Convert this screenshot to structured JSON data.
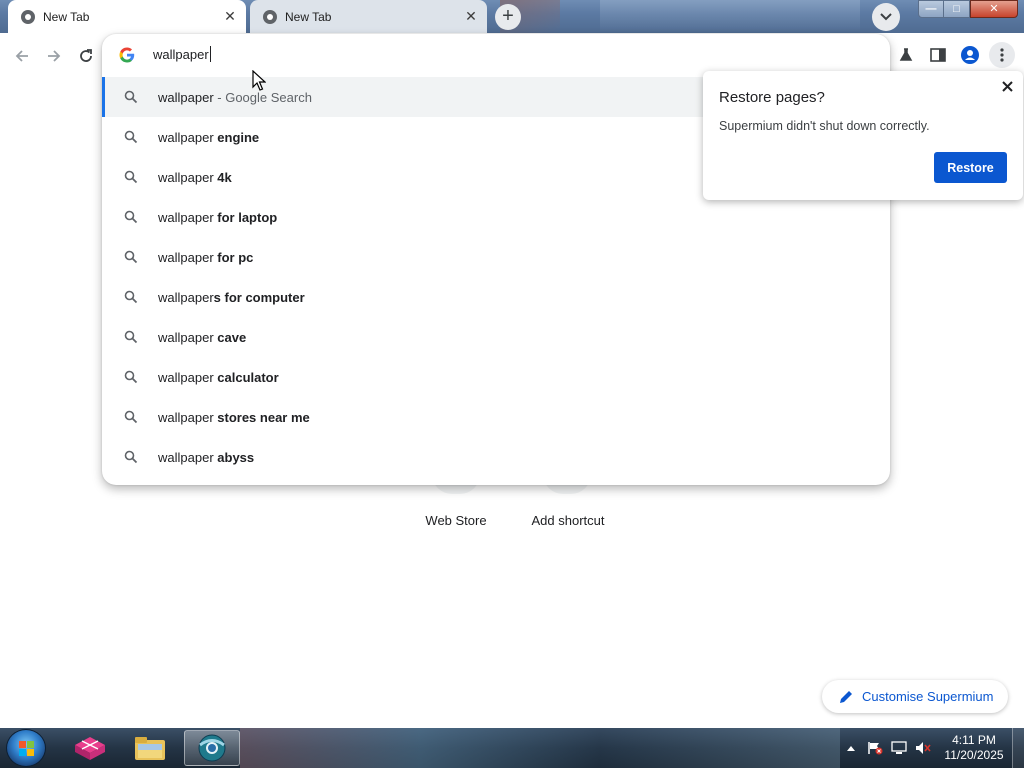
{
  "tabs": [
    {
      "title": "New Tab",
      "active": true
    },
    {
      "title": "New Tab",
      "active": false
    }
  ],
  "omnibox": {
    "value": "wallpaper"
  },
  "suggestions": [
    {
      "prefix": "wallpaper",
      "bold": "",
      "suffix": " - Google Search",
      "selected": true
    },
    {
      "prefix": "wallpaper",
      "bold": " engine",
      "suffix": "",
      "selected": false
    },
    {
      "prefix": "wallpaper",
      "bold": " 4k",
      "suffix": "",
      "selected": false
    },
    {
      "prefix": "wallpaper",
      "bold": " for laptop",
      "suffix": "",
      "selected": false
    },
    {
      "prefix": "wallpaper",
      "bold": " for pc",
      "suffix": "",
      "selected": false
    },
    {
      "prefix": "wallpaper",
      "bold": "s for computer",
      "suffix": "",
      "selected": false
    },
    {
      "prefix": "wallpaper",
      "bold": " cave",
      "suffix": "",
      "selected": false
    },
    {
      "prefix": "wallpaper",
      "bold": " calculator",
      "suffix": "",
      "selected": false
    },
    {
      "prefix": "wallpaper",
      "bold": " stores near me",
      "suffix": "",
      "selected": false
    },
    {
      "prefix": "wallpaper",
      "bold": " abyss",
      "suffix": "",
      "selected": false
    }
  ],
  "restore_dialog": {
    "title": "Restore pages?",
    "message": "Supermium didn't shut down correctly.",
    "button": "Restore"
  },
  "shortcuts": [
    {
      "label": "Web Store"
    },
    {
      "label": "Add shortcut"
    }
  ],
  "customise_button": "Customise Supermium",
  "taskbar": {
    "time": "4:11 PM",
    "date": "11/20/2025"
  },
  "colors": {
    "accent": "#0b57d0",
    "selection_bar": "#1a73e8"
  }
}
